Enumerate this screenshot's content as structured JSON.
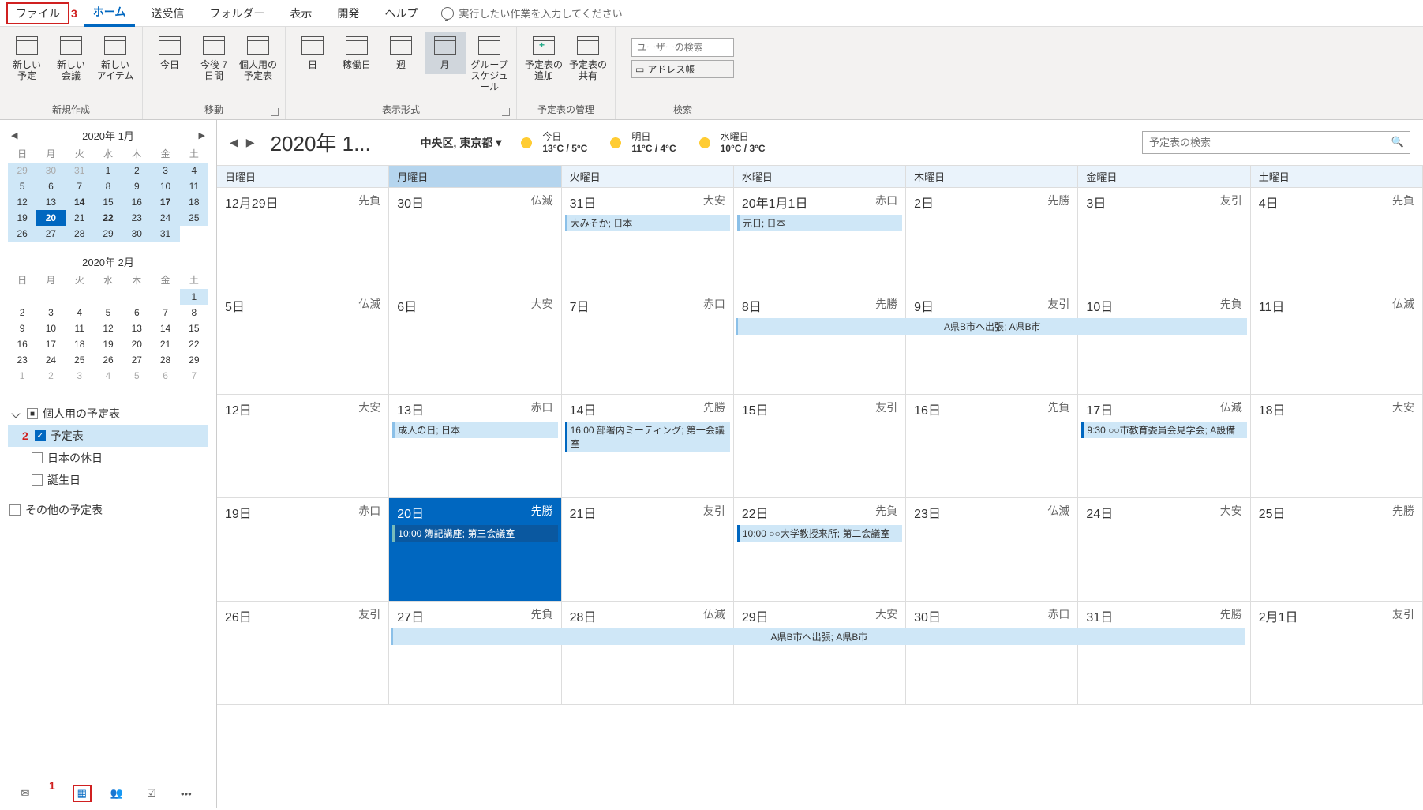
{
  "menubar": {
    "file": "ファイル",
    "annot3": "3",
    "home": "ホーム",
    "send_recv": "送受信",
    "folder": "フォルダー",
    "view": "表示",
    "dev": "開発",
    "help": "ヘルプ",
    "tellme": "実行したい作業を入力してください"
  },
  "ribbon": {
    "new": {
      "label": "新規作成",
      "appt": "新しい\n予定",
      "meeting": "新しい\n会議",
      "items": "新しい\nアイテム"
    },
    "go": {
      "label": "移動",
      "today": "今日",
      "next7": "今後\n7 日間",
      "personal": "個人用の\n予定表"
    },
    "arrange": {
      "label": "表示形式",
      "day": "日",
      "workweek": "稼働日",
      "week": "週",
      "month": "月",
      "schedule": "グループ\nスケジュール"
    },
    "manage": {
      "label": "予定表の管理",
      "add": "予定表の\n追加",
      "share": "予定表の\n共有"
    },
    "search": {
      "label": "検索",
      "user_ph": "ユーザーの検索",
      "addr": "アドレス帳"
    }
  },
  "sidebar": {
    "mini1": {
      "title": "2020年 1月",
      "dows": [
        "日",
        "月",
        "火",
        "水",
        "木",
        "金",
        "土"
      ],
      "days": [
        {
          "n": 29,
          "c": "prev highlight"
        },
        {
          "n": 30,
          "c": "prev highlight"
        },
        {
          "n": 31,
          "c": "prev highlight"
        },
        {
          "n": 1,
          "c": "highlight"
        },
        {
          "n": 2,
          "c": "highlight"
        },
        {
          "n": 3,
          "c": "highlight"
        },
        {
          "n": 4,
          "c": "highlight"
        },
        {
          "n": 5,
          "c": "highlight"
        },
        {
          "n": 6,
          "c": "highlight"
        },
        {
          "n": 7,
          "c": "highlight"
        },
        {
          "n": 8,
          "c": "highlight"
        },
        {
          "n": 9,
          "c": "highlight"
        },
        {
          "n": 10,
          "c": "highlight"
        },
        {
          "n": 11,
          "c": "highlight"
        },
        {
          "n": 12,
          "c": "highlight"
        },
        {
          "n": 13,
          "c": "highlight"
        },
        {
          "n": 14,
          "c": "highlight bold"
        },
        {
          "n": 15,
          "c": "highlight"
        },
        {
          "n": 16,
          "c": "highlight"
        },
        {
          "n": 17,
          "c": "highlight bold"
        },
        {
          "n": 18,
          "c": "highlight"
        },
        {
          "n": 19,
          "c": "highlight"
        },
        {
          "n": 20,
          "c": "today"
        },
        {
          "n": 21,
          "c": "highlight"
        },
        {
          "n": 22,
          "c": "highlight bold"
        },
        {
          "n": 23,
          "c": "highlight"
        },
        {
          "n": 24,
          "c": "highlight"
        },
        {
          "n": 25,
          "c": "highlight"
        },
        {
          "n": 26,
          "c": "highlight"
        },
        {
          "n": 27,
          "c": "highlight"
        },
        {
          "n": 28,
          "c": "highlight"
        },
        {
          "n": 29,
          "c": "highlight"
        },
        {
          "n": 30,
          "c": "highlight"
        },
        {
          "n": 31,
          "c": "highlight"
        },
        {
          "n": "",
          "c": ""
        }
      ]
    },
    "mini2": {
      "title": "2020年 2月",
      "dows": [
        "日",
        "月",
        "火",
        "水",
        "木",
        "金",
        "土"
      ],
      "days": [
        {
          "n": "",
          "c": ""
        },
        {
          "n": "",
          "c": ""
        },
        {
          "n": "",
          "c": ""
        },
        {
          "n": "",
          "c": ""
        },
        {
          "n": "",
          "c": ""
        },
        {
          "n": "",
          "c": ""
        },
        {
          "n": 1,
          "c": "highlight"
        },
        {
          "n": 2,
          "c": ""
        },
        {
          "n": 3,
          "c": ""
        },
        {
          "n": 4,
          "c": ""
        },
        {
          "n": 5,
          "c": ""
        },
        {
          "n": 6,
          "c": ""
        },
        {
          "n": 7,
          "c": ""
        },
        {
          "n": 8,
          "c": ""
        },
        {
          "n": 9,
          "c": ""
        },
        {
          "n": 10,
          "c": ""
        },
        {
          "n": 11,
          "c": ""
        },
        {
          "n": 12,
          "c": ""
        },
        {
          "n": 13,
          "c": ""
        },
        {
          "n": 14,
          "c": ""
        },
        {
          "n": 15,
          "c": ""
        },
        {
          "n": 16,
          "c": ""
        },
        {
          "n": 17,
          "c": ""
        },
        {
          "n": 18,
          "c": ""
        },
        {
          "n": 19,
          "c": ""
        },
        {
          "n": 20,
          "c": ""
        },
        {
          "n": 21,
          "c": ""
        },
        {
          "n": 22,
          "c": ""
        },
        {
          "n": 23,
          "c": ""
        },
        {
          "n": 24,
          "c": ""
        },
        {
          "n": 25,
          "c": ""
        },
        {
          "n": 26,
          "c": ""
        },
        {
          "n": 27,
          "c": ""
        },
        {
          "n": 28,
          "c": ""
        },
        {
          "n": 29,
          "c": ""
        },
        {
          "n": 1,
          "c": "next"
        },
        {
          "n": 2,
          "c": "next"
        },
        {
          "n": 3,
          "c": "next"
        },
        {
          "n": 4,
          "c": "next"
        },
        {
          "n": 5,
          "c": "next"
        },
        {
          "n": 6,
          "c": "next"
        },
        {
          "n": 7,
          "c": "next"
        }
      ]
    },
    "tree": {
      "personal": "個人用の予定表",
      "annot2": "2",
      "calendar": "予定表",
      "holidays": "日本の休日",
      "birthday": "誕生日",
      "other": "その他の予定表"
    },
    "nav_annot1": "1"
  },
  "content": {
    "title": "2020年 1...",
    "location": "中央区, 東京都",
    "weather": [
      {
        "label": "今日",
        "temp": "13°C / 5°C",
        "icon": "sun"
      },
      {
        "label": "明日",
        "temp": "11°C / 4°C",
        "icon": "sun"
      },
      {
        "label": "水曜日",
        "temp": "10°C / 3°C",
        "icon": "cloud"
      }
    ],
    "search_ph": "予定表の検索",
    "dow_headers": [
      "日曜日",
      "月曜日",
      "火曜日",
      "水曜日",
      "木曜日",
      "金曜日",
      "土曜日"
    ],
    "cells": [
      [
        {
          "d": "12月29日",
          "r": "先負"
        },
        {
          "d": "30日",
          "r": "仏滅"
        },
        {
          "d": "31日",
          "r": "大安",
          "ev": [
            {
              "t": "大みそか; 日本",
              "c": "light"
            }
          ]
        },
        {
          "d": "20年1月1日",
          "r": "赤口",
          "ev": [
            {
              "t": "元日; 日本",
              "c": "light"
            }
          ]
        },
        {
          "d": "2日",
          "r": "先勝"
        },
        {
          "d": "3日",
          "r": "友引"
        },
        {
          "d": "4日",
          "r": "先負"
        }
      ],
      [
        {
          "d": "5日",
          "r": "仏滅"
        },
        {
          "d": "6日",
          "r": "大安"
        },
        {
          "d": "7日",
          "r": "赤口"
        },
        {
          "d": "8日",
          "r": "先勝",
          "span": {
            "t": "A県B市へ出張; A県B市",
            "cols": 3
          }
        },
        {
          "d": "9日",
          "r": "友引"
        },
        {
          "d": "10日",
          "r": "先負"
        },
        {
          "d": "11日",
          "r": "仏滅"
        }
      ],
      [
        {
          "d": "12日",
          "r": "大安"
        },
        {
          "d": "13日",
          "r": "赤口",
          "ev": [
            {
              "t": "成人の日; 日本",
              "c": "light"
            }
          ]
        },
        {
          "d": "14日",
          "r": "先勝",
          "ev": [
            {
              "t": "16:00 部署内ミーティング; 第一会議室"
            }
          ]
        },
        {
          "d": "15日",
          "r": "友引"
        },
        {
          "d": "16日",
          "r": "先負"
        },
        {
          "d": "17日",
          "r": "仏滅",
          "ev": [
            {
              "t": "9:30 ○○市教育委員会見学会; A設備"
            }
          ]
        },
        {
          "d": "18日",
          "r": "大安"
        }
      ],
      [
        {
          "d": "19日",
          "r": "赤口"
        },
        {
          "d": "20日",
          "r": "先勝",
          "today": true,
          "ev": [
            {
              "t": "10:00 簿記講座; 第三会議室"
            }
          ]
        },
        {
          "d": "21日",
          "r": "友引"
        },
        {
          "d": "22日",
          "r": "先負",
          "ev": [
            {
              "t": "10:00 ○○大学教授来所; 第二会議室"
            }
          ]
        },
        {
          "d": "23日",
          "r": "仏滅"
        },
        {
          "d": "24日",
          "r": "大安"
        },
        {
          "d": "25日",
          "r": "先勝"
        }
      ],
      [
        {
          "d": "26日",
          "r": "友引"
        },
        {
          "d": "27日",
          "r": "先負",
          "span": {
            "t": "A県B市へ出張; A県B市",
            "cols": 5
          }
        },
        {
          "d": "28日",
          "r": "仏滅"
        },
        {
          "d": "29日",
          "r": "大安"
        },
        {
          "d": "30日",
          "r": "赤口"
        },
        {
          "d": "31日",
          "r": "先勝"
        },
        {
          "d": "2月1日",
          "r": "友引"
        }
      ]
    ]
  }
}
